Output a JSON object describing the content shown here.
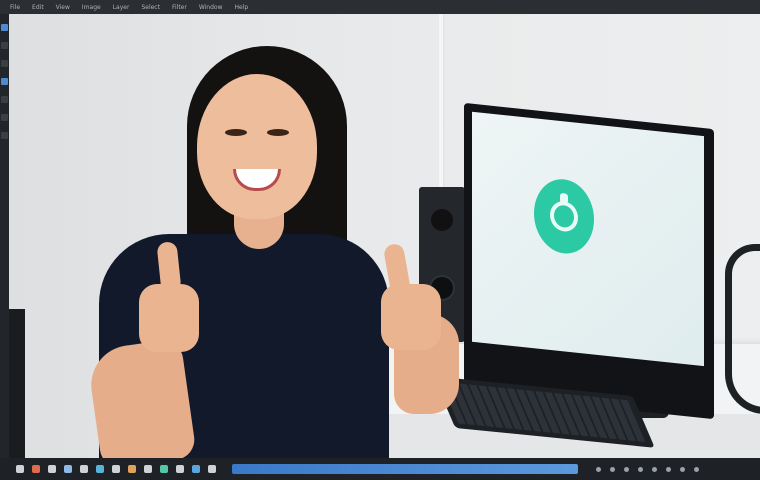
{
  "menubar": {
    "items": [
      "File",
      "Edit",
      "View",
      "Image",
      "Layer",
      "Select",
      "Filter",
      "Window",
      "Help"
    ]
  },
  "toolstrip": {
    "tools": [
      {
        "name": "move-tool",
        "color": "#4f8ad1"
      },
      {
        "name": "select-tool",
        "color": "#3b3f45"
      },
      {
        "name": "lasso-tool",
        "color": "#3b3f45"
      },
      {
        "name": "crop-tool",
        "color": "#4f8ad1"
      },
      {
        "name": "brush-tool",
        "color": "#3b3f45"
      },
      {
        "name": "eraser-tool",
        "color": "#3b3f45"
      },
      {
        "name": "text-tool",
        "color": "#3b3f45"
      }
    ]
  },
  "canvas": {
    "image_subject": "photo",
    "app_logo_color": "#2bc9a4"
  },
  "taskbar": {
    "icons": [
      {
        "name": "start-icon",
        "color": "#cfd3d8"
      },
      {
        "name": "browser-icon",
        "color": "#e06b4f"
      },
      {
        "name": "files-icon",
        "color": "#cfd3d8"
      },
      {
        "name": "mail-icon",
        "color": "#8fb9e6"
      },
      {
        "name": "chat-icon",
        "color": "#cfd3d8"
      },
      {
        "name": "editor-icon",
        "color": "#56b3d9"
      },
      {
        "name": "music-icon",
        "color": "#cfd3d8"
      },
      {
        "name": "photos-icon",
        "color": "#e0a35a"
      },
      {
        "name": "settings-icon",
        "color": "#cfd3d8"
      },
      {
        "name": "store-icon",
        "color": "#54c7a8"
      },
      {
        "name": "terminal-icon",
        "color": "#cfd3d8"
      },
      {
        "name": "app-icon",
        "color": "#5aa7e0"
      },
      {
        "name": "folder-icon",
        "color": "#cfd3d8"
      }
    ],
    "tray_count": 8
  }
}
